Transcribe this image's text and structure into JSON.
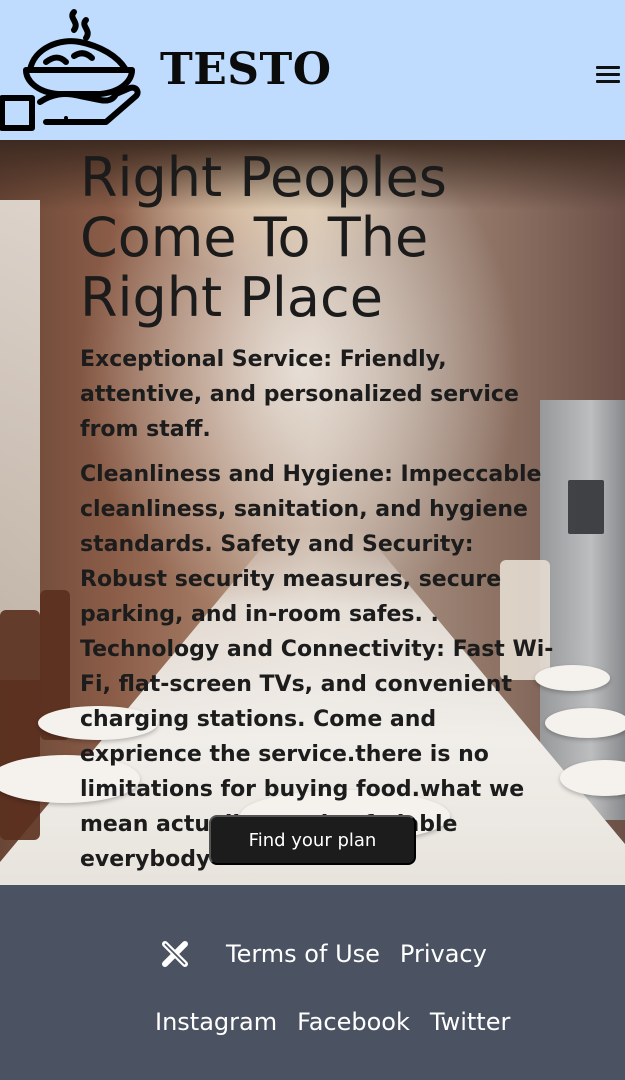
{
  "header": {
    "brand": "TESTO",
    "logo_icon": "serving-dish-hand-icon",
    "menu_icon": "hamburger-menu-icon",
    "background_color": "#bfdbfe"
  },
  "hero": {
    "title": "Right Peoples Come To The Right Place",
    "paragraph_1": "Exceptional Service: Friendly, attentive, and personalized service from staff.",
    "paragraph_2": "Cleanliness and Hygiene: Impeccable cleanliness, sanitation, and hygiene standards. Safety and Security: Robust security measures, secure parking, and in-room safes. . Technology and Connectivity: Fast Wi-Fi, flat-screen TVs, and convenient charging stations. Come and exprience the service.there is no limitations for buying food.what we mean actually rate is afodable everybody",
    "cta_label": "Find your plan"
  },
  "footer": {
    "icon": "x-logo-icon",
    "links_row_1": [
      "Terms of Use",
      "Privacy"
    ],
    "links_row_2": [
      "Instagram",
      "Facebook",
      "Twitter"
    ],
    "background_color": "#4b5362"
  }
}
